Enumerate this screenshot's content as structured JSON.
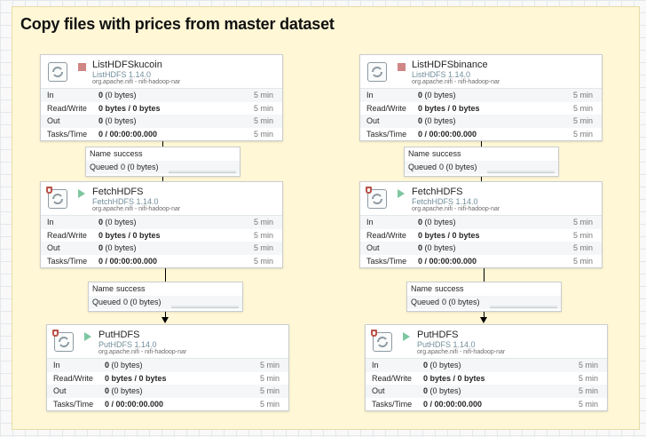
{
  "group": {
    "title": "Copy files with prices from master dataset"
  },
  "labels": {
    "in": "In",
    "read_write": "Read/Write",
    "out": "Out",
    "tasks_time": "Tasks/Time",
    "name": "Name",
    "queued": "Queued"
  },
  "processors": [
    {
      "name": "ListHDFSkucoin",
      "type": "ListHDFS 1.14.0",
      "bundle": "org.apache.nifi - nifi-hadoop-nar",
      "state": "stopped",
      "in_count": "0",
      "in_bytes": "(0 bytes)",
      "rw": "0 bytes / 0 bytes",
      "out_count": "0",
      "out_bytes": "(0 bytes)",
      "tasks": "0 / 00:00:00.000",
      "window": "5 min"
    },
    {
      "name": "ListHDFSbinance",
      "type": "ListHDFS 1.14.0",
      "bundle": "org.apache.nifi - nifi-hadoop-nar",
      "state": "stopped",
      "in_count": "0",
      "in_bytes": "(0 bytes)",
      "rw": "0 bytes / 0 bytes",
      "out_count": "0",
      "out_bytes": "(0 bytes)",
      "tasks": "0 / 00:00:00.000",
      "window": "5 min"
    },
    {
      "name": "FetchHDFS",
      "type": "FetchHDFS 1.14.0",
      "bundle": "org.apache.nifi - nifi-hadoop-nar",
      "state": "running",
      "in_count": "0",
      "in_bytes": "(0 bytes)",
      "rw": "0 bytes / 0 bytes",
      "out_count": "0",
      "out_bytes": "(0 bytes)",
      "tasks": "0 / 00:00:00.000",
      "window": "5 min"
    },
    {
      "name": "FetchHDFS",
      "type": "FetchHDFS 1.14.0",
      "bundle": "org.apache.nifi - nifi-hadoop-nar",
      "state": "running",
      "in_count": "0",
      "in_bytes": "(0 bytes)",
      "rw": "0 bytes / 0 bytes",
      "out_count": "0",
      "out_bytes": "(0 bytes)",
      "tasks": "0 / 00:00:00.000",
      "window": "5 min"
    },
    {
      "name": "PutHDFS",
      "type": "PutHDFS 1.14.0",
      "bundle": "org.apache.nifi - nifi-hadoop-nar",
      "state": "running",
      "in_count": "0",
      "in_bytes": "(0 bytes)",
      "rw": "0 bytes / 0 bytes",
      "out_count": "0",
      "out_bytes": "(0 bytes)",
      "tasks": "0 / 00:00:00.000",
      "window": "5 min"
    },
    {
      "name": "PutHDFS",
      "type": "PutHDFS 1.14.0",
      "bundle": "org.apache.nifi - nifi-hadoop-nar",
      "state": "running",
      "in_count": "0",
      "in_bytes": "(0 bytes)",
      "rw": "0 bytes / 0 bytes",
      "out_count": "0",
      "out_bytes": "(0 bytes)",
      "tasks": "0 / 00:00:00.000",
      "window": "5 min"
    }
  ],
  "connections": [
    {
      "name": "success",
      "queued": "0 (0 bytes)"
    },
    {
      "name": "success",
      "queued": "0 (0 bytes)"
    },
    {
      "name": "success",
      "queued": "0 (0 bytes)"
    },
    {
      "name": "success",
      "queued": "0 (0 bytes)"
    }
  ],
  "colors": {
    "group_bg": "#fff7d6",
    "stopped": "#d18686",
    "running": "#7dc7a0",
    "type_text": "#728e9b"
  },
  "icons": {
    "processor": "processor-icon",
    "restricted": "restricted-shield-icon",
    "stopped": "stop-square-icon",
    "running": "play-triangle-icon"
  }
}
